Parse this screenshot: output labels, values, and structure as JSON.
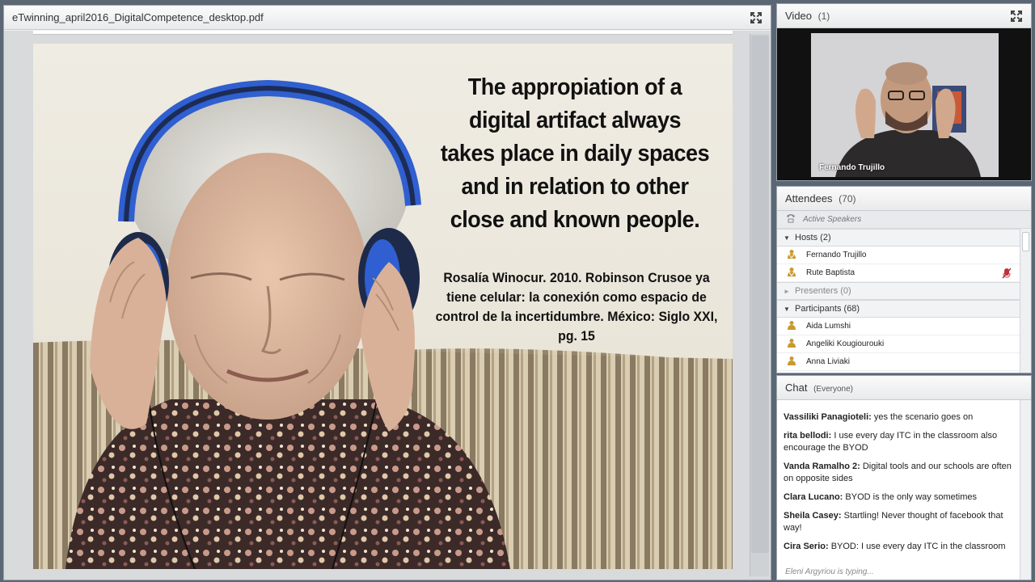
{
  "share": {
    "title": "eTwinning_april2016_DigitalCompetence_desktop.pdf",
    "slide": {
      "quote_lines": [
        "The appropiation of a",
        "digital artifact always",
        "takes place in daily spaces",
        "and in relation to other",
        "close and known people."
      ],
      "citation_lines": [
        "Rosalía Winocur. 2010. Robinson Crusoe ya",
        "tiene celular: la conexión como espacio de",
        "control de la incertidumbre. México: Siglo XXI,",
        "pg. 15"
      ]
    }
  },
  "video": {
    "title": "Video",
    "count": "(1)",
    "speaker_name": "Fernando Trujillo"
  },
  "attendees": {
    "title": "Attendees",
    "count": "(70)",
    "active_speakers": "Active Speakers",
    "hosts_label": "Hosts (2)",
    "hosts": [
      "Fernando Trujillo",
      "Rute Baptista"
    ],
    "presenters_label": "Presenters (0)",
    "participants_label": "Participants (68)",
    "participants": [
      "Aida Lumshi",
      "Angeliki Kougiourouki",
      "Anna  Liviaki"
    ]
  },
  "chat": {
    "title": "Chat",
    "scope": "(Everyone)",
    "messages": [
      {
        "who": "Vassiliki Panagioteli:",
        "text": " yes the scenario goes on"
      },
      {
        "who": "rita bellodi:",
        "text": "  I use every day ITC in the classroom  also encourage the BYOD"
      },
      {
        "who": "Vanda  Ramalho 2:",
        "text": " Digital tools and our schools are often on opposite sides"
      },
      {
        "who": "Clara Lucano:",
        "text": " BYOD is the only way sometimes"
      },
      {
        "who": "Sheila Casey:",
        "text": " Startling! Never thought of facebook that way!"
      },
      {
        "who": "Cira Serio:",
        "text": " BYOD: I use every day ITC in the classroom"
      }
    ],
    "typing": "Eleni Argyriou is typing..."
  },
  "colors": {
    "background": "#5b6775",
    "headphone_blue": "#2f5fd0",
    "mic_muted": "#c0303a"
  }
}
